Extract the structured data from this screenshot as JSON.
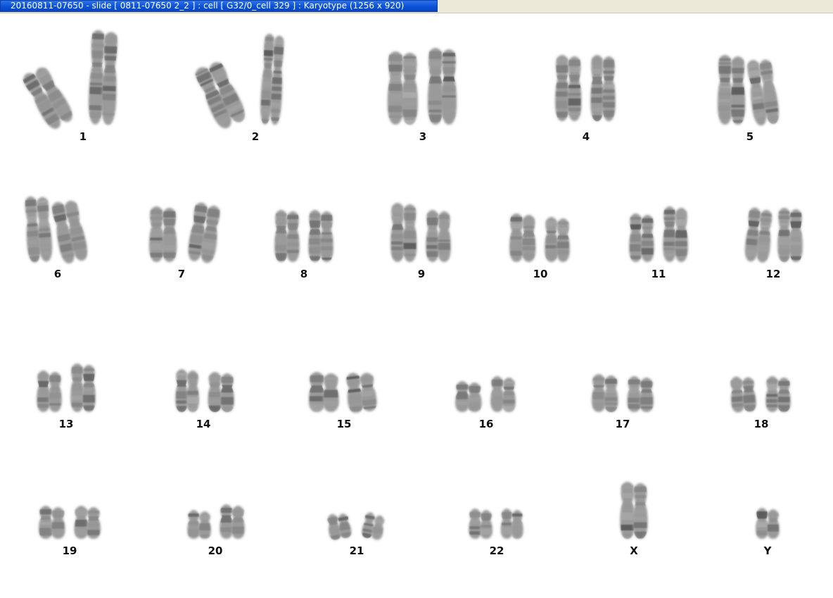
{
  "window": {
    "title": "20160811-07650 - slide [ 0811-07650 2_2 ] : cell [ G32/0_cell 329 ] : Karyotype  (1256 x 920)"
  },
  "karyotype": {
    "labels": [
      "1",
      "2",
      "3",
      "4",
      "5",
      "6",
      "7",
      "8",
      "9",
      "10",
      "11",
      "12",
      "13",
      "14",
      "15",
      "16",
      "17",
      "18",
      "19",
      "20",
      "21",
      "22",
      "X",
      "Y"
    ]
  }
}
